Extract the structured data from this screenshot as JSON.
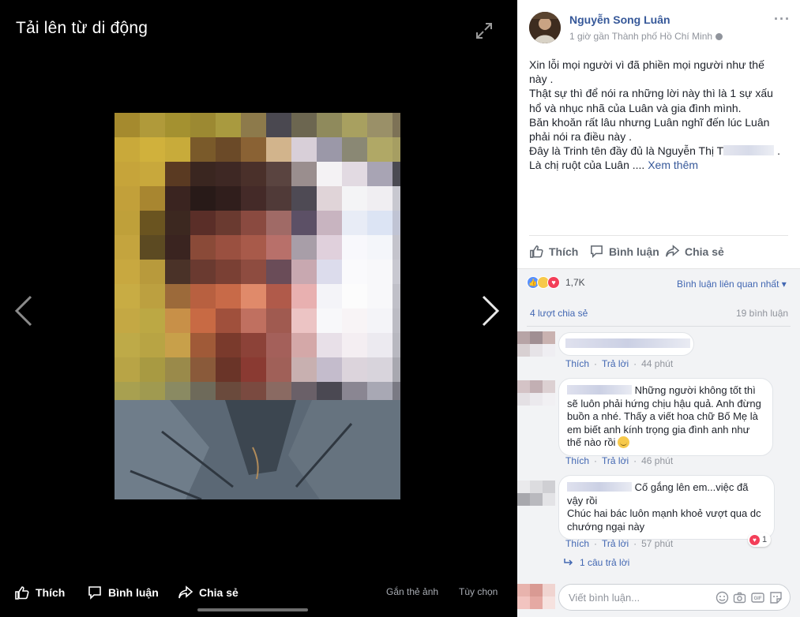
{
  "viewer": {
    "title": "Tải lên từ di động",
    "actions": {
      "like": "Thích",
      "comment": "Bình luận",
      "share": "Chia sẻ",
      "tag_photo": "Gắn thẻ ảnh",
      "options": "Tùy chọn"
    }
  },
  "post": {
    "author": "Nguyễn Song Luân",
    "time_location": "1 giờ gần Thành phố Hồ Chí Minh",
    "more_icon": "more-horizontal-icon",
    "lines": [
      "Xin lỗi mọi người vì đã phiền mọi người như thế",
      "này .",
      "Thật sự thì để nói ra những lời này thì là 1 sự xấu",
      "hổ và nhục nhã của Luân và gia đình mình.",
      "Băn khoăn rất lâu nhưng Luân nghĩ đến lúc Luân",
      "phải nói ra điều này .",
      "Đây là Trinh tên đầy đủ là Nguyễn Thị T",
      "Là chị ruột của Luân .... "
    ],
    "line7_end": ".",
    "see_more": "Xem thêm",
    "actions": {
      "like": "Thích",
      "comment": "Bình luận",
      "share": "Chia sẻ"
    }
  },
  "feedback": {
    "reaction_count": "1,7K",
    "relevant_label": "Bình luận liên quan nhất",
    "shares": "4 lượt chia sẻ",
    "comments_count": "19 bình luận"
  },
  "comments": [
    {
      "text": "",
      "like": "Thích",
      "reply": "Trả lời",
      "time": "44 phút"
    },
    {
      "text_lines": [
        "Những người không tốt thì",
        "sẽ luôn phải hứng chịu hậu quả. Anh đừng",
        "buồn a nhé. Thấy a viết hoa chữ Bố Mẹ là",
        "em biết anh kính trọng gia đình anh như",
        "thế nào rồi"
      ],
      "like": "Thích",
      "reply": "Trả lời",
      "time": "46 phút"
    },
    {
      "text_lines": [
        "Cố gắng lên em...việc đã",
        "vậy rồi",
        "Chúc hai bác luôn mạnh khoẻ vượt qua dc",
        "chướng ngại này"
      ],
      "like": "Thích",
      "reply": "Trả lời",
      "time": "57 phút",
      "reaction_count": "1",
      "replies_label": "1 câu trả lời"
    }
  ],
  "write_comment": {
    "placeholder": "Viết bình luận..."
  },
  "colors": {
    "link": "#365899",
    "link_alt": "#4267b2",
    "muted": "#90949c",
    "feedback_bg": "#f2f3f5"
  }
}
